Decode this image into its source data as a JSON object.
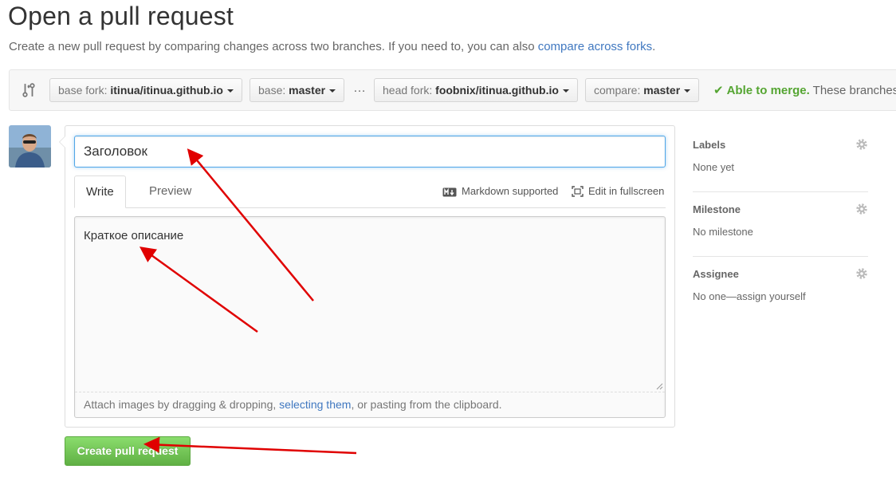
{
  "header": {
    "title": "Open a pull request",
    "subtitle": "Create a new pull request by comparing changes across two branches. If you need to, you can also",
    "subtitle_link": "compare across forks",
    "subtitle_end": "."
  },
  "range": {
    "base_fork_label": "base fork:",
    "base_fork_value": "itinua/itinua.github.io",
    "base_label": "base:",
    "base_value": "master",
    "separator": "…",
    "head_fork_label": "head fork:",
    "head_fork_value": "foobnix/itinua.github.io",
    "compare_label": "compare:",
    "compare_value": "master",
    "merge_status": "Able to merge.",
    "merge_message": "These branches c"
  },
  "form": {
    "title_value": "Заголовок",
    "tabs": [
      {
        "label": "Write"
      },
      {
        "label": "Preview"
      }
    ],
    "markdown_label": "Markdown supported",
    "fullscreen_label": "Edit in fullscreen",
    "body_value": "Краткое описание",
    "attach_before": "Attach images by dragging & dropping,",
    "attach_link": "selecting them",
    "attach_after": ", or pasting from the clipboard.",
    "submit_label": "Create pull request"
  },
  "sidebar": {
    "labels": {
      "heading": "Labels",
      "value": "None yet"
    },
    "milestone": {
      "heading": "Milestone",
      "value": "No milestone"
    },
    "assignee": {
      "heading": "Assignee",
      "value": "No one—assign yourself"
    }
  },
  "colors": {
    "link": "#4078c0",
    "success": "#55a532",
    "button": "#60b044",
    "annotation_arrow": "#e00000"
  },
  "icons": [
    "git-compare-icon",
    "check-icon",
    "markdown-icon",
    "fullscreen-icon",
    "gear-icon",
    "avatar"
  ]
}
